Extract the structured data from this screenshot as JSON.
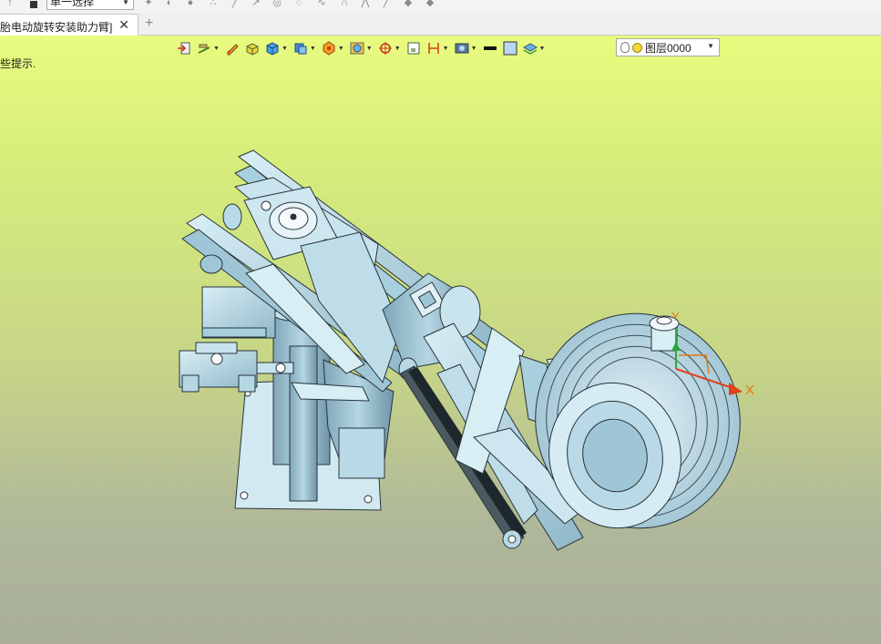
{
  "top_toolbar": {
    "selection_combo": {
      "value": "单一选择"
    },
    "icons": [
      "pointer-icon",
      "select-filter-icon",
      "render-icon",
      "snap-icon",
      "line-icon",
      "point-icon",
      "circle-icon",
      "arc-icon",
      "spline-icon",
      "polyline-icon",
      "shade-icon",
      "layer-stack-icon"
    ]
  },
  "tabs": {
    "document_tab": {
      "label": "胎电动旋转安装助力臂]",
      "close_glyph": "✕"
    },
    "new_tab_glyph": "+"
  },
  "viewport": {
    "hint": "些提示.",
    "toolbar": {
      "buttons": [
        "import-icon",
        "measure-icon",
        "sketch-icon",
        "box-icon",
        "cube-view-icon",
        "view-cube-icon",
        "display-mode-icon",
        "material-icon",
        "fit-view-icon",
        "dimension-icon",
        "frame-icon",
        "render-settings-icon",
        "color-swatch-icon",
        "background-icon",
        "layers-icon"
      ],
      "layer_combo": {
        "value": "图层0000"
      }
    },
    "triad": {
      "x_label": "X",
      "y_label": "Y"
    },
    "colors": {
      "background_top": "#e9fb7f",
      "background_bottom": "#a8ae99",
      "model_fill": "#b9dce8",
      "model_edge": "#27343a",
      "triad_x": "#e0401a",
      "triad_y": "#2aa83a",
      "triad_z": "#e07a10"
    }
  }
}
